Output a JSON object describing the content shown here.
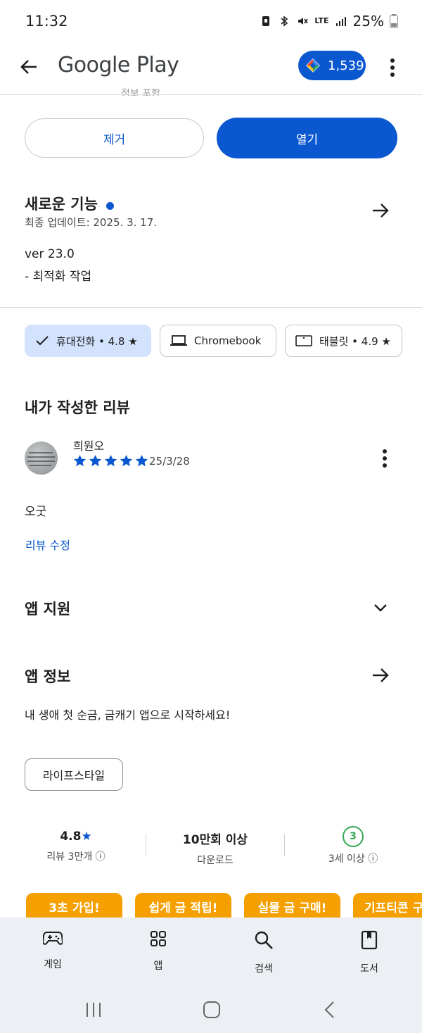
{
  "status_bar": {
    "time": "11:32",
    "network": "LTE",
    "battery": "25%"
  },
  "header": {
    "title": "Google Play",
    "points": "1,539"
  },
  "clipped_text": "정보 포함",
  "actions": {
    "remove_label": "제거",
    "open_label": "열기"
  },
  "whats_new": {
    "title": "새로운 기능",
    "updated": "최종 업데이트: 2025. 3. 17.",
    "version": "ver 23.0",
    "note": "- 최적화 작업"
  },
  "device_chips": [
    {
      "label": "휴대전화 • 4.8 ★",
      "selected": true
    },
    {
      "label": "Chromebook",
      "selected": false
    },
    {
      "label": "태블릿 • 4.9 ★",
      "selected": false
    }
  ],
  "my_review": {
    "title": "내가 작성한 리뷰",
    "author": "희원오",
    "rating": 5,
    "date": "25/3/28",
    "text": "오굿",
    "edit_label": "리뷰 수정"
  },
  "app_support": {
    "title": "앱 지원"
  },
  "app_info": {
    "title": "앱 정보",
    "description": "내 생애 첫 순금, 금캐기 앱으로 시작하세요!",
    "category": "라이프스타일"
  },
  "stats": {
    "rating": "4.8",
    "rating_label": "리뷰 3만개",
    "downloads": "10만회 이상",
    "downloads_label": "다운로드",
    "age_badge": "3",
    "age_label": "3세 이상"
  },
  "screenshots": [
    "3초 가입!",
    "쉽게 금 적립!",
    "실물 금 구매!",
    "기프티콘 구"
  ],
  "bottom_nav": [
    {
      "label": "게임",
      "icon": "gamepad-icon"
    },
    {
      "label": "앱",
      "icon": "apps-grid-icon"
    },
    {
      "label": "검색",
      "icon": "search-icon"
    },
    {
      "label": "도서",
      "icon": "book-icon"
    }
  ],
  "colors": {
    "accent": "#0b57d0",
    "chip_selected": "#d3e3fd",
    "age_badge": "#34a853",
    "promo": "#f5a000"
  }
}
